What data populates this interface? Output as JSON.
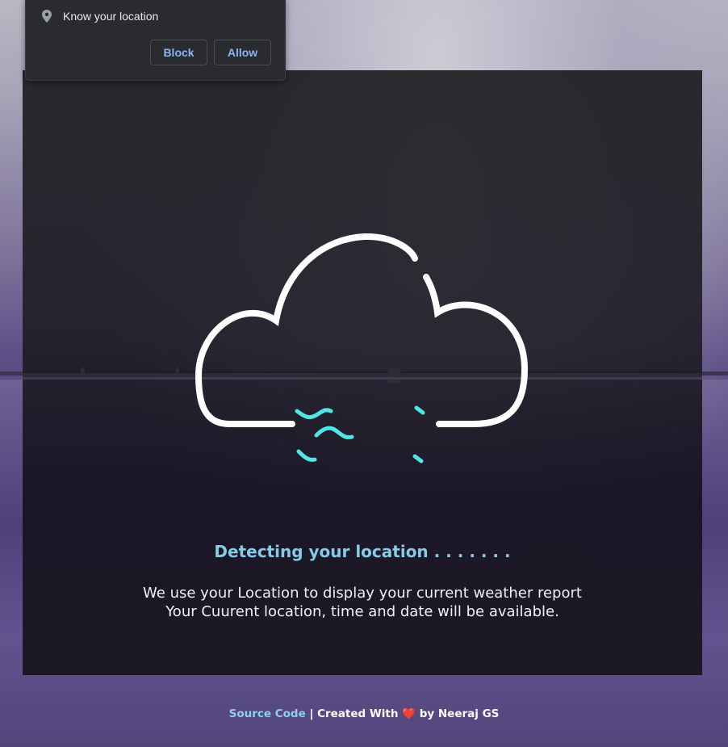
{
  "permission_popup": {
    "message": "Know your location",
    "block_label": "Block",
    "allow_label": "Allow",
    "icon": "location-pin-icon"
  },
  "loader": {
    "icon": "rain-cloud-icon",
    "status": "Detecting your location . . . . . . .",
    "description_line1": "We use your Location to display your current weather report",
    "description_line2": "Your Cuurent location, time and date will be available."
  },
  "footer": {
    "source_link": "Source Code",
    "separator": "|",
    "created_with": "Created With",
    "heart": "❤️",
    "by_author": "by Neeraj GS"
  },
  "colors": {
    "accent": "#86cbe8",
    "rain": "#4fe6e6",
    "heart": "#e53935",
    "popup_button_text": "#8ab4f8"
  }
}
